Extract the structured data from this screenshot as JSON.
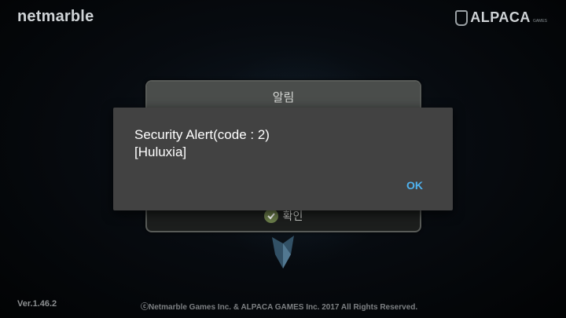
{
  "branding": {
    "publisher_logo": "netmarble",
    "developer_logo": "ALPACA",
    "developer_logo_sub": "GAMES"
  },
  "notice_dialog": {
    "title": "알림",
    "confirm_label": "확인",
    "confirm_icon": "check-circle-icon"
  },
  "alert_dialog": {
    "line1": "Security Alert(code : 2)",
    "line2": "[Huluxia]",
    "ok_label": "OK",
    "ok_color": "#4fb3f0"
  },
  "footer": {
    "version": "Ver.1.46.2",
    "copyright": "ⓒNetmarble Games Inc. & ALPACA GAMES Inc. 2017 All Rights Reserved."
  }
}
